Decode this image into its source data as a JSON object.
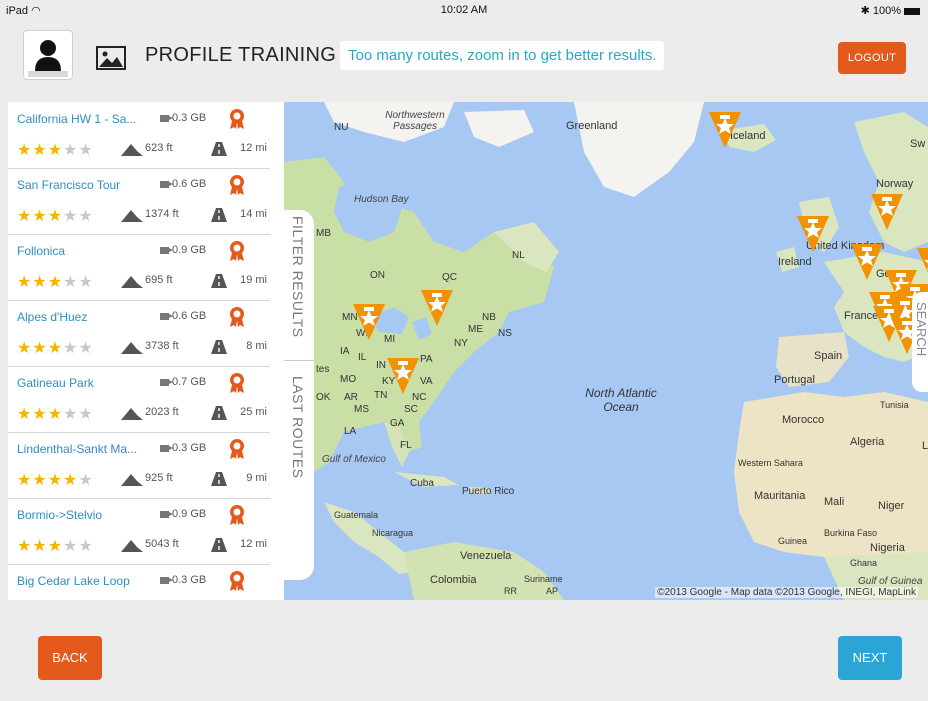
{
  "statusbar": {
    "device": "iPad",
    "time": "10:02 AM",
    "battery": "100%"
  },
  "header": {
    "title": "PROFILE TRAINING",
    "notice": "Too many routes, zoom in to get better results.",
    "logout_label": "LOGOUT"
  },
  "routes": [
    {
      "name": "California HW 1 - Sa...",
      "size": "0.3 GB",
      "stars": 3,
      "elevation": "623 ft",
      "distance": "12 mi"
    },
    {
      "name": "San Francisco Tour",
      "size": "0.6 GB",
      "stars": 3,
      "elevation": "1374 ft",
      "distance": "14 mi"
    },
    {
      "name": "Follonica",
      "size": "0.9 GB",
      "stars": 3,
      "elevation": "695 ft",
      "distance": "19 mi"
    },
    {
      "name": "Alpes d'Huez",
      "size": "0.6 GB",
      "stars": 3,
      "elevation": "3738 ft",
      "distance": "8 mi"
    },
    {
      "name": "Gatineau Park",
      "size": "0.7 GB",
      "stars": 3,
      "elevation": "2023 ft",
      "distance": "25 mi"
    },
    {
      "name": "Lindenthal-Sankt Ma...",
      "size": "0.3 GB",
      "stars": 4,
      "elevation": "925 ft",
      "distance": "9 mi"
    },
    {
      "name": "Bormio->Stelvio",
      "size": "0.9 GB",
      "stars": 3,
      "elevation": "5043 ft",
      "distance": "12 mi"
    },
    {
      "name": "Big Cedar Lake Loop",
      "size": "0.3 GB",
      "stars": null,
      "elevation": "",
      "distance": ""
    }
  ],
  "tabs": {
    "filter": "FILTER RESULTS",
    "last_routes": "LAST ROUTES",
    "search": "SEARCH"
  },
  "map": {
    "copyright": "©2013 Google - Map data ©2013 Google, INEGI, MapLink",
    "labels": {
      "northwestern": "Northwestern Passages",
      "greenland": "Greenland",
      "iceland": "Iceland",
      "hudson": "Hudson Bay",
      "nu": "NU",
      "mb": "MB",
      "on": "ON",
      "qc": "QC",
      "nl": "NL",
      "mn": "MN",
      "nb": "NB",
      "ns": "NS",
      "me": "ME",
      "ny": "NY",
      "pa": "PA",
      "ia": "IA",
      "il": "IL",
      "in": "IN",
      "mo": "MO",
      "ky": "KY",
      "va": "VA",
      "ok": "OK",
      "ar": "AR",
      "tn": "TN",
      "nc": "NC",
      "ms": "MS",
      "sc": "SC",
      "ga": "GA",
      "la": "LA",
      "fl": "FL",
      "mi": "MI",
      "wi": "WI",
      "tes": "tes",
      "gulf_mexico": "Gulf of Mexico",
      "cuba": "Cuba",
      "puerto_rico": "Puerto Rico",
      "guatemala": "Guatemala",
      "nicaragua": "Nicaragua",
      "venezuela": "Venezuela",
      "colombia": "Colombia",
      "suriname": "Suriname",
      "rr": "RR",
      "ap": "AP",
      "north_atlantic": "North Atlantic Ocean",
      "norway": "Norway",
      "sw": "Sw",
      "ireland": "Ireland",
      "united_kingdom": "United Kingdom",
      "germany": "Germ",
      "france": "France",
      "spain": "Spain",
      "portugal": "Portugal",
      "morocco": "Morocco",
      "tunisia": "Tunisia",
      "algeria": "Algeria",
      "l": "L",
      "western_sahara": "Western Sahara",
      "mauritania": "Mauritania",
      "mali": "Mali",
      "niger": "Niger",
      "burkina": "Burkina Faso",
      "guinea": "Guinea",
      "nigeria": "Nigeria",
      "ghana": "Ghana",
      "gulf_guinea": "Gulf of Guinea"
    }
  },
  "footer": {
    "back_label": "BACK",
    "next_label": "NEXT"
  },
  "colors": {
    "accent_orange": "#e35a1c",
    "accent_blue": "#2ba5d6",
    "pin": "#f39200",
    "link": "#2e8ec4"
  }
}
